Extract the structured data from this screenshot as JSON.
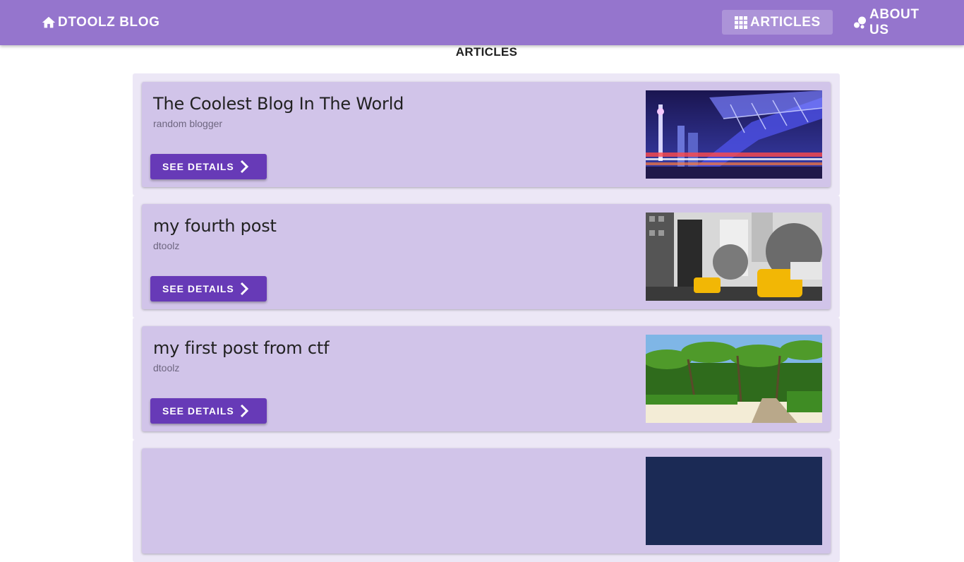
{
  "app": {
    "brand_label": "DTOOLZ BLOG",
    "brand_icon": "home-icon"
  },
  "nav": {
    "articles_label": "ARTICLES",
    "articles_icon": "grid-icon",
    "about_label": "ABOUT US",
    "about_icon": "bubbles-icon"
  },
  "page": {
    "section_title": "ARTICLES"
  },
  "colors": {
    "topbar": "#9575cd",
    "card": "#d1c4e9",
    "card_outer": "#ece7f6",
    "button": "#673ab7"
  },
  "articles": [
    {
      "title": "The Coolest Blog In The World",
      "author": "random blogger",
      "button_label": "SEE DETAILS",
      "image": "city-bridge-night"
    },
    {
      "title": "my fourth post",
      "author": "dtoolz",
      "button_label": "SEE DETAILS",
      "image": "street-yellow-taxis"
    },
    {
      "title": "my first post from ctf",
      "author": "dtoolz",
      "button_label": "SEE DETAILS",
      "image": "tropical-palms"
    },
    {
      "title": "",
      "author": "",
      "button_label": "",
      "image": "night-sky"
    }
  ]
}
